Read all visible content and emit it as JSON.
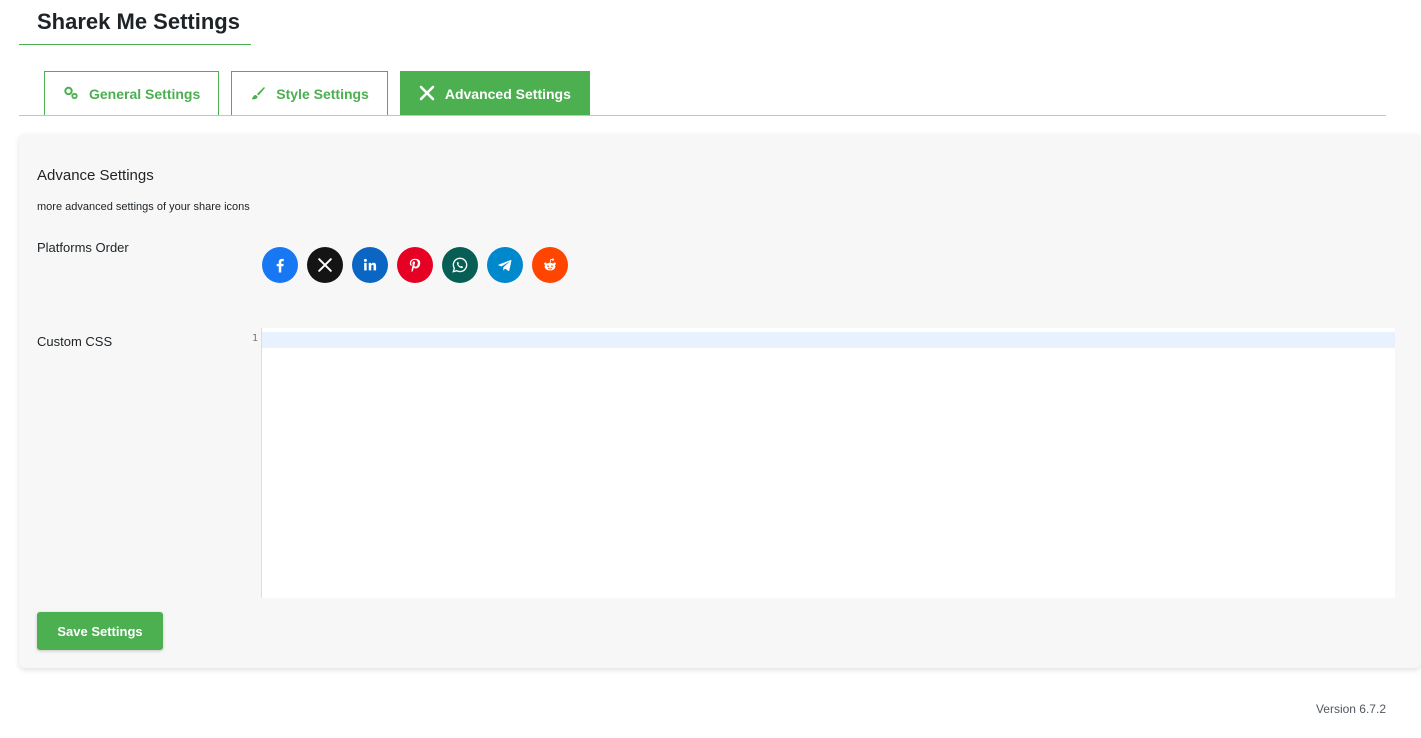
{
  "page": {
    "title": "Sharek Me Settings"
  },
  "tabs": [
    {
      "label": "General Settings",
      "icon": "gears-icon",
      "active": false
    },
    {
      "label": "Style Settings",
      "icon": "brush-icon",
      "active": false
    },
    {
      "label": "Advanced Settings",
      "icon": "tools-icon",
      "active": true
    }
  ],
  "section": {
    "title": "Advance Settings",
    "description": "more advanced settings of your share icons"
  },
  "platforms_order": {
    "label": "Platforms Order",
    "items": [
      {
        "name": "facebook",
        "icon": "facebook-icon",
        "color": "#1877f2"
      },
      {
        "name": "x",
        "icon": "x-icon",
        "color": "#141414"
      },
      {
        "name": "linkedin",
        "icon": "linkedin-icon",
        "color": "#0a66c2"
      },
      {
        "name": "pinterest",
        "icon": "pinterest-icon",
        "color": "#e60023"
      },
      {
        "name": "whatsapp",
        "icon": "whatsapp-icon",
        "color": "#075e54"
      },
      {
        "name": "telegram",
        "icon": "telegram-icon",
        "color": "#0088cc"
      },
      {
        "name": "reddit",
        "icon": "reddit-icon",
        "color": "#ff4500"
      }
    ]
  },
  "custom_css": {
    "label": "Custom CSS",
    "line_number": "1",
    "value": ""
  },
  "save_label": "Save Settings",
  "footer": {
    "version": "Version 6.7.2"
  },
  "colors": {
    "accent": "#4caf50",
    "panel_bg": "#f7f7f7"
  }
}
